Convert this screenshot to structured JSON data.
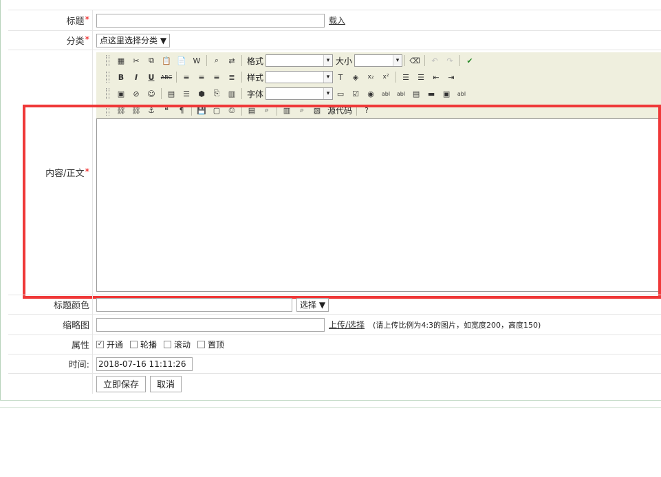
{
  "form": {
    "title": {
      "label": "标题",
      "required": "*",
      "value": "",
      "action": "载入"
    },
    "category": {
      "label": "分类",
      "required": "*",
      "selected": "点这里选择分类 ▼"
    },
    "content": {
      "label": "内容/正文",
      "required": "*"
    },
    "title_color": {
      "label": "标题颜色",
      "value": "",
      "button": "选择 ▼"
    },
    "thumbnail": {
      "label": "缩略图",
      "value": "",
      "action": "上传/选择",
      "hint": "(请上传比例为4:3的图片，如宽度200，高度150)"
    },
    "attributes": {
      "label": "属性",
      "options": [
        {
          "label": "开通",
          "checked": true
        },
        {
          "label": "轮播",
          "checked": false
        },
        {
          "label": "滚动",
          "checked": false
        },
        {
          "label": "置顶",
          "checked": false
        }
      ]
    },
    "time": {
      "label": "时间:",
      "value": "2018-07-16 11:11:26"
    },
    "save_label": "立即保存",
    "cancel_label": "取消"
  },
  "editor": {
    "format_label": "格式",
    "size_label": "大小",
    "style_label": "样式",
    "font_label": "字体",
    "source_label": "源代码"
  }
}
